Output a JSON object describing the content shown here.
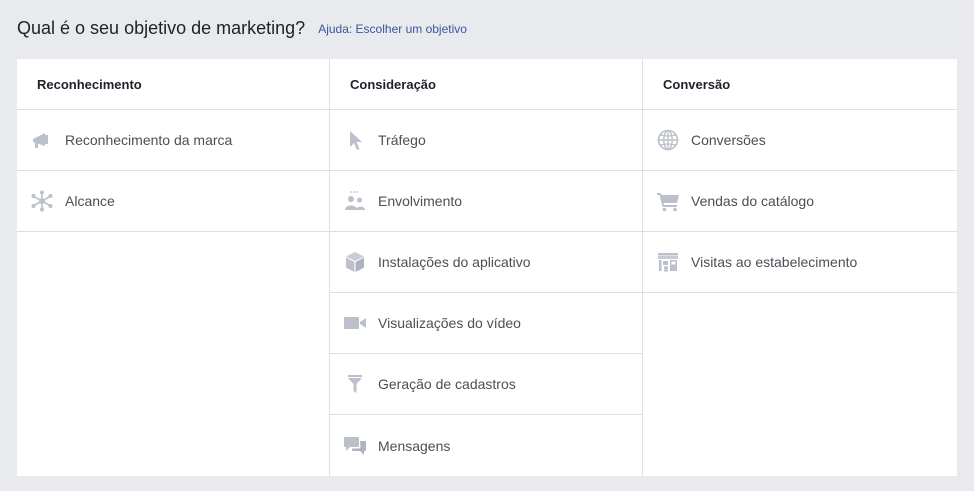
{
  "header": {
    "title": "Qual é o seu objetivo de marketing?",
    "help_link": "Ajuda: Escolher um objetivo"
  },
  "colors": {
    "background": "#e9eaed",
    "panel": "#ffffff",
    "border": "#dddfe2",
    "icon": "#bcc0ca",
    "link": "#365899",
    "text": "#4b4f56"
  },
  "columns": [
    {
      "title": "Reconhecimento",
      "items": [
        {
          "label": "Reconhecimento da marca",
          "icon": "megaphone-icon"
        },
        {
          "label": "Alcance",
          "icon": "network-icon"
        }
      ]
    },
    {
      "title": "Consideração",
      "items": [
        {
          "label": "Tráfego",
          "icon": "cursor-icon"
        },
        {
          "label": "Envolvimento",
          "icon": "people-icon"
        },
        {
          "label": "Instalações do aplicativo",
          "icon": "box-icon"
        },
        {
          "label": "Visualizações do vídeo",
          "icon": "video-camera-icon"
        },
        {
          "label": "Geração de cadastros",
          "icon": "funnel-icon"
        },
        {
          "label": "Mensagens",
          "icon": "chat-bubbles-icon"
        }
      ]
    },
    {
      "title": "Conversão",
      "items": [
        {
          "label": "Conversões",
          "icon": "globe-icon"
        },
        {
          "label": "Vendas do catálogo",
          "icon": "shopping-cart-icon"
        },
        {
          "label": "Visitas ao estabelecimento",
          "icon": "storefront-icon"
        }
      ]
    }
  ]
}
